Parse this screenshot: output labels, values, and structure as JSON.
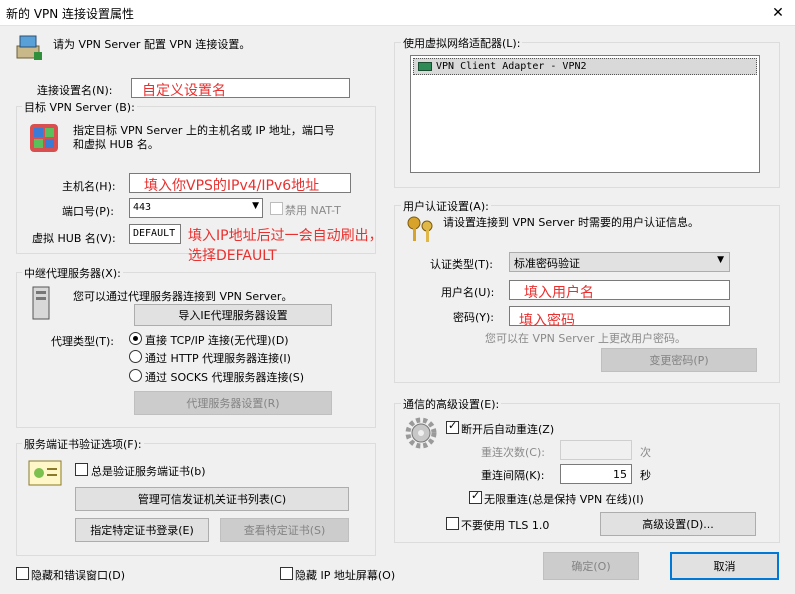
{
  "window": {
    "title": "新的 VPN 连接设置属性",
    "close": "✕"
  },
  "intro": {
    "text": "请为 VPN Server 配置 VPN 连接设置。"
  },
  "conn_name": {
    "label": "连接设置名(N):",
    "value": "自定义设置名"
  },
  "target_server": {
    "group_label": "目标 VPN Server (B):",
    "desc_line1": "指定目标 VPN Server 上的主机名或 IP 地址，端口号",
    "desc_line2": "和虚拟 HUB 名。",
    "host_label": "主机名(H):",
    "host_value": "填入你VPS的IPv4/IPv6地址",
    "port_label": "端口号(P):",
    "port_value": "443",
    "disable_nat_label": "禁用 NAT-T",
    "hub_label": "虚拟 HUB 名(V):",
    "hub_value": "DEFAULT",
    "hub_note_line1": "填入IP地址后过一会自动刷出，",
    "hub_note_line2": "选择DEFAULT"
  },
  "proxy": {
    "group_label": "中继代理服务器(X):",
    "desc": "您可以通过代理服务器连接到 VPN Server。",
    "import_button": "导入IE代理服务器设置",
    "type_label": "代理类型(T):",
    "options": [
      "直接 TCP/IP 连接(无代理)(D)",
      "通过 HTTP 代理服务器连接(I)",
      "通过 SOCKS 代理服务器连接(S)"
    ],
    "settings_button": "代理服务器设置(R)"
  },
  "cert": {
    "group_label": "服务端证书验证选项(F):",
    "always_verify_label": "总是验证服务端证书(b)",
    "manage_button": "管理可信发证机关证书列表(C)",
    "specify_button": "指定特定证书登录(E)",
    "view_button": "查看特定证书(S)"
  },
  "bottom_checks": {
    "hide_errors": "隐藏和错误窗口(D)",
    "hide_ip": "隐藏 IP 地址屏幕(O)"
  },
  "adapter": {
    "group_label": "使用虚拟网络适配器(L):",
    "items": [
      "VPN Client Adapter - VPN2"
    ]
  },
  "auth": {
    "group_label": "用户认证设置(A):",
    "desc": "请设置连接到 VPN Server 时需要的用户认证信息。",
    "type_label": "认证类型(T):",
    "type_value": "标准密码验证",
    "user_label": "用户名(U):",
    "user_value": "填入用户名",
    "pass_label": "密码(Y):",
    "pass_value": "填入密码",
    "note": "您可以在 VPN Server 上更改用户密码。",
    "change_pw_button": "变更密码(P)"
  },
  "advanced": {
    "group_label": "通信的高级设置(E):",
    "reconnect_label": "断开后自动重连(Z)",
    "retries_label": "重连次数(C):",
    "retries_unit": "次",
    "interval_label": "重连间隔(K):",
    "interval_value": "15",
    "interval_unit": "秒",
    "infinite_label": "无限重连(总是保持 VPN 在线)(I)",
    "no_tls_label": "不要使用 TLS 1.0",
    "advanced_button": "高级设置(D)..."
  },
  "footer": {
    "ok": "确定(O)",
    "cancel": "取消"
  }
}
